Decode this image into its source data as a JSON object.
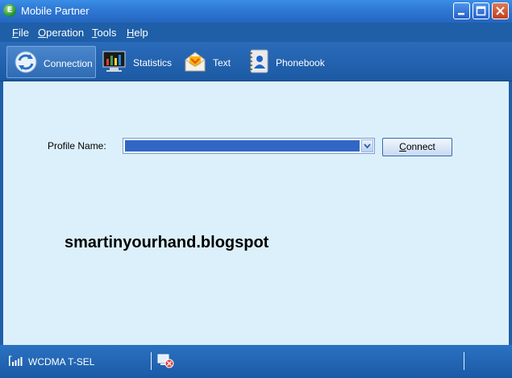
{
  "window": {
    "title": "Mobile Partner",
    "app_icon_letter": "E"
  },
  "menu": {
    "items": [
      {
        "label": "File",
        "underline": "F"
      },
      {
        "label": "Operation",
        "underline": "O"
      },
      {
        "label": "Tools",
        "underline": "T"
      },
      {
        "label": "Help",
        "underline": "H"
      }
    ]
  },
  "toolbar": {
    "items": [
      {
        "label": "Connection",
        "icon": "connection-icon",
        "active": true
      },
      {
        "label": "Statistics",
        "icon": "statistics-icon",
        "active": false
      },
      {
        "label": "Text",
        "icon": "envelope-icon",
        "active": false
      },
      {
        "label": "Phonebook",
        "icon": "phonebook-icon",
        "active": false
      }
    ]
  },
  "main": {
    "profile_label": "Profile Name:",
    "profile_value": "",
    "connect_label": "Connect",
    "watermark": "smartinyourhand.blogspot"
  },
  "status": {
    "network": "WCDMA T-SEL",
    "signal_icon": "signal-bars-icon",
    "connection_icon": "disconnected-icon"
  },
  "colors": {
    "titlebar": "#2f7ad6",
    "chrome": "#1f5fa8",
    "content_bg": "#dcf0fb",
    "selection": "#3166c4"
  }
}
